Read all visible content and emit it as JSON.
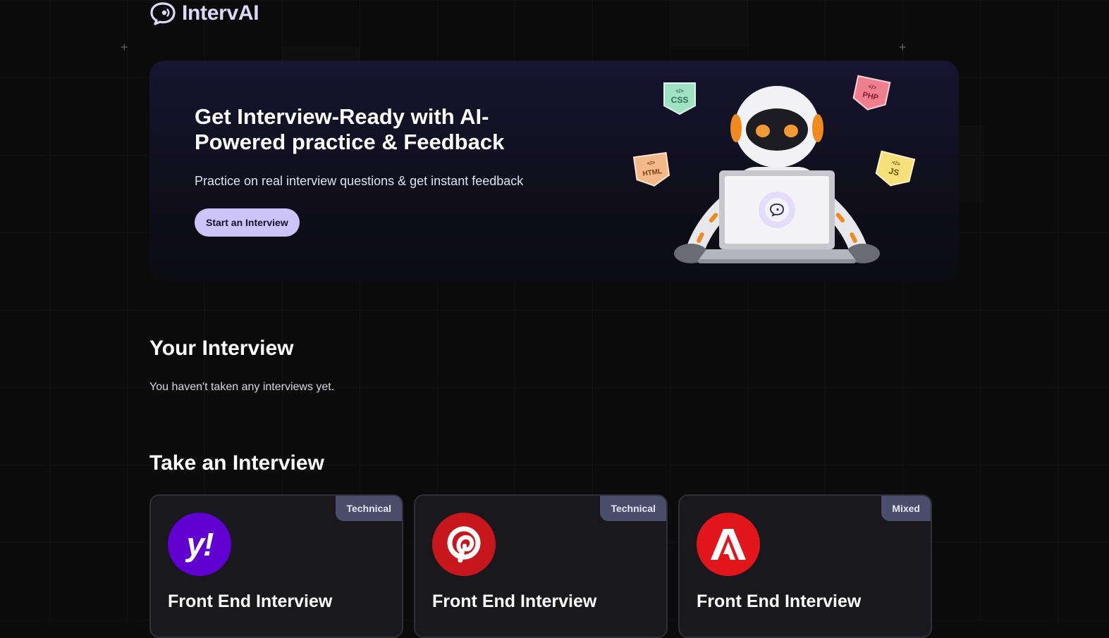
{
  "nav": {
    "brand": "IntervAI"
  },
  "hero": {
    "title": "Get Interview-Ready with AI-Powered practice & Feedback",
    "subtitle": "Practice on real interview questions & get instant feedback",
    "cta_label": "Start an Interview",
    "tech_tags": [
      "CSS",
      "PHP",
      "HTML",
      "JS"
    ]
  },
  "your_interviews": {
    "heading": "Your Interview",
    "empty_message": "You haven't taken any interviews yet."
  },
  "take_interview": {
    "heading": "Take an Interview",
    "cards": [
      {
        "title": "Front End Interview",
        "type": "Technical",
        "logo": "yahoo-logo",
        "color": "#6001d2"
      },
      {
        "title": "Front End Interview",
        "type": "Technical",
        "logo": "pinterest-logo",
        "color": "#c8161d"
      },
      {
        "title": "Front End Interview",
        "type": "Mixed",
        "logo": "adobe-logo",
        "color": "#e1161b"
      }
    ]
  },
  "colors": {
    "accent": "#cdc4fa",
    "background": "#0b0b0c",
    "badge": "#4a4e6a"
  }
}
